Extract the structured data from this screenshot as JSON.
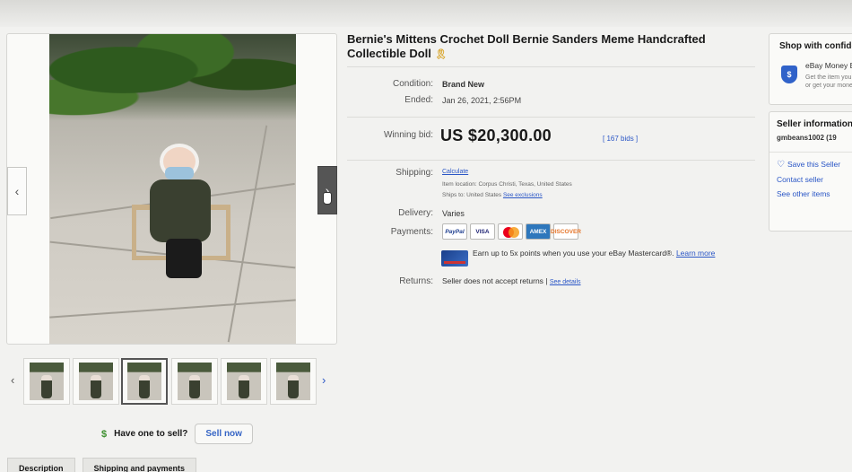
{
  "listing": {
    "title": "Bernie's Mittens Crochet Doll Bernie Sanders Meme Handcrafted Collectible Doll",
    "title_icon": "ribbon-icon"
  },
  "details": {
    "condition_label": "Condition:",
    "condition_value": "Brand New",
    "ended_label": "Ended:",
    "ended_value": "Jan 26, 2021, 2:56PM",
    "winning_bid_label": "Winning bid:",
    "winning_bid_value": "US $20,300.00",
    "bids": "[ 167 bids ]",
    "shipping_label": "Shipping:",
    "shipping_value": "Calculate",
    "item_location": "Item location: Corpus Christi, Texas, United States",
    "ships_to": "Ships to: United States",
    "see_exclusions": "See exclusions",
    "delivery_label": "Delivery:",
    "delivery_value": "Varies",
    "payments_label": "Payments:",
    "payment_methods": [
      "PayPal",
      "VISA",
      "Mastercard",
      "AMEX",
      "DISCOVER"
    ],
    "earn_text": "Earn up to 5x points when you use your eBay Mastercard®.",
    "learn_more": "Learn more",
    "returns_label": "Returns:",
    "returns_value": "Seller does not accept returns |",
    "see_details": "See details"
  },
  "gallery": {
    "prev_arrow": "‹",
    "next_arrow": "›",
    "thumb_prev": "‹",
    "thumb_next": "›",
    "thumbnail_count": 6,
    "active_thumbnail": 3
  },
  "sell": {
    "prompt": "Have one to sell?",
    "button": "Sell now"
  },
  "tabs": [
    "Description",
    "Shipping and payments"
  ],
  "sidebar": {
    "shop_title": "Shop with confidence",
    "money_back_title": "eBay Money Back Guarantee",
    "money_back_desc": "Get the item you ordered or get your money back.",
    "seller_title": "Seller information",
    "seller_id": "gmbeans1002 (19",
    "save_seller": "Save this Seller",
    "contact_seller": "Contact seller",
    "see_other_items": "See other items"
  },
  "colors": {
    "link": "#2a56c6",
    "page_bg": "#f2f2f0",
    "text": "#191919"
  }
}
